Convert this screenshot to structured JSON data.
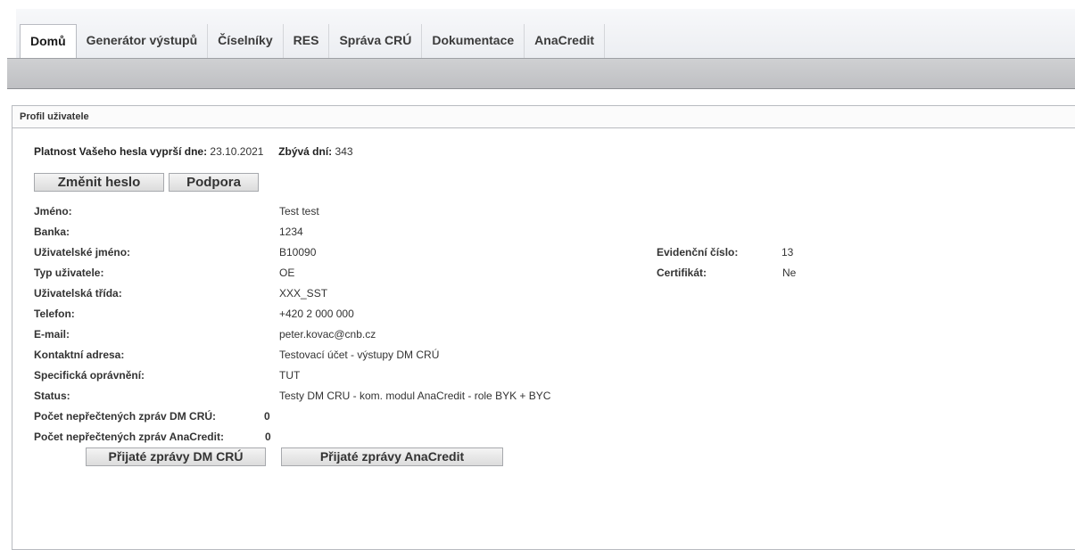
{
  "tabs": [
    {
      "label": "Domů",
      "active": true
    },
    {
      "label": "Generátor výstupů",
      "active": false
    },
    {
      "label": "Číselníky",
      "active": false
    },
    {
      "label": "RES",
      "active": false
    },
    {
      "label": "Správa CRÚ",
      "active": false
    },
    {
      "label": "Dokumentace",
      "active": false
    },
    {
      "label": "AnaCredit",
      "active": false
    }
  ],
  "panel": {
    "title": "Profil uživatele"
  },
  "password": {
    "expiry_label": "Platnost Vašeho hesla vyprší dne:",
    "expiry_date": "23.10.2021",
    "days_label": "Zbývá dní:",
    "days_value": "343"
  },
  "buttons": {
    "change_password": "Změnit heslo",
    "support": "Podpora",
    "received_dm_cru": "Přijaté zprávy DM CRÚ",
    "received_anacredit": "Přijaté zprávy AnaCredit"
  },
  "profile": [
    {
      "label": "Jméno:",
      "value": "Test test"
    },
    {
      "label": "Banka:",
      "value": "1234"
    },
    {
      "label": "Uživatelské jméno:",
      "value": "B10090"
    },
    {
      "label": "Typ uživatele:",
      "value": "OE"
    },
    {
      "label": "Uživatelská třída:",
      "value": "XXX_SST"
    },
    {
      "label": "Telefon:",
      "value": "+420 2 000 000"
    },
    {
      "label": "E-mail:",
      "value": "peter.kovac@cnb.cz"
    },
    {
      "label": "Kontaktní adresa:",
      "value": "Testovací účet - výstupy DM CRÚ"
    },
    {
      "label": "Specifická oprávnění:",
      "value": "TUT"
    },
    {
      "label": "Status:",
      "value": "Testy DM CRU - kom. modul AnaCredit - role BYK + BYC"
    },
    {
      "label": "Počet nepřečtených zpráv DM CRÚ:",
      "value": "0"
    },
    {
      "label": "Počet nepřečtených zpráv AnaCredit:",
      "value": "0"
    }
  ],
  "side": {
    "evid_label": "Evidenční číslo:",
    "evid_value": "13",
    "cert_label": "Certifikát:",
    "cert_value": "Ne"
  }
}
